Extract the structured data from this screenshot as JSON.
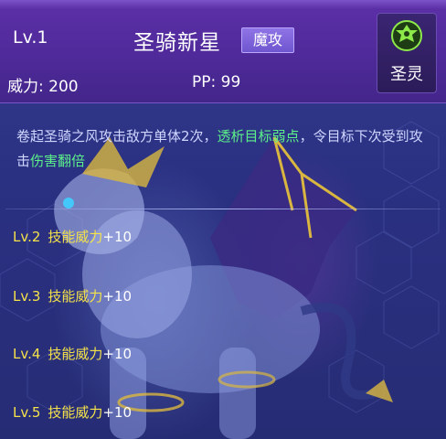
{
  "header": {
    "level": "Lv.1",
    "skill_name": "圣骑新星",
    "skill_type": "魔攻",
    "power": "威力: 200",
    "pp": "PP: 99",
    "attribute": {
      "name": "圣灵",
      "icon": "holy-spirit-icon",
      "icon_color": "#8de84a"
    }
  },
  "description": {
    "part1": "卷起圣骑之风攻击敌方单体2次，",
    "highlight1": "透析目标弱点",
    "part2": "，令目标下次受到攻击",
    "highlight2": "伤害翻倍"
  },
  "upgrades": [
    {
      "level": "Lv.2",
      "label": "技能威力",
      "value": "+10"
    },
    {
      "level": "Lv.3",
      "label": "技能威力",
      "value": "+10"
    },
    {
      "level": "Lv.4",
      "label": "技能威力",
      "value": "+10"
    },
    {
      "level": "Lv.5",
      "label": "技能威力",
      "value": "+10"
    }
  ],
  "colors": {
    "highlight": "#5cf08a",
    "upgrade_text": "#f4e24a",
    "header": "#4f2a9a"
  }
}
